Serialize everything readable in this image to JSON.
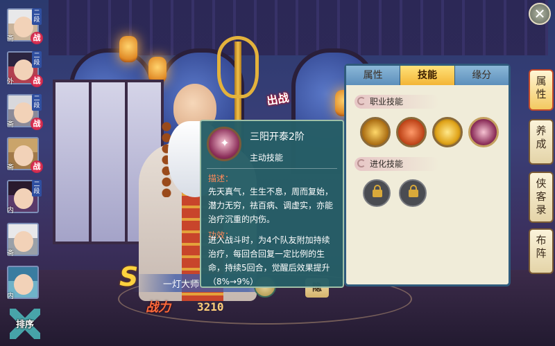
{
  "team": [
    {
      "rank": "二段",
      "faction": "斋",
      "battle": "战"
    },
    {
      "rank": "二段",
      "faction": "外",
      "battle": "战"
    },
    {
      "rank": "二段",
      "faction": "斋",
      "battle": "战"
    },
    {
      "rank": "",
      "faction": "斋",
      "battle": "战"
    },
    {
      "rank": "二段",
      "faction": "内",
      "battle": ""
    },
    {
      "rank": "",
      "faction": "斋",
      "battle": ""
    },
    {
      "rank": "",
      "faction": "内",
      "battle": ""
    }
  ],
  "sort_label": "排序",
  "hero": {
    "deploy_label": "出战",
    "name": "一灯大师",
    "power_label": "战力",
    "power_value": "3210",
    "hide_label": "隐"
  },
  "panel": {
    "tabs": [
      "属性",
      "技能",
      "缘分"
    ],
    "active_tab": "技能",
    "section_career": "职业技能",
    "section_evolve": "进化技能",
    "career_skill_icons": [
      "golden-slash-icon",
      "lotus-flame-icon",
      "citrus-wheel-icon",
      "deer-skill-icon"
    ],
    "locked_icons": [
      "lock-icon",
      "lock-icon"
    ]
  },
  "side_tabs": [
    "属性",
    "养成",
    "侠客录",
    "布阵"
  ],
  "tooltip": {
    "name": "三阳开泰2阶",
    "type": "主动技能",
    "desc_label": "描述：",
    "desc_text": "先天真气，生生不息，周而复始，潜力无穷，祛百病、调虚实，亦能治疗沉重的内伤。",
    "effect_label": "功效：",
    "effect_text": "进入战斗时，为4个队友附加持续治疗，每回合回复一定比例的生命，持续5回合，觉醒后效果提升（8%→9%）"
  },
  "colors": {
    "accent": "#f3b536",
    "panel_bg": "#f0ecd9",
    "tooltip_bg": "#265e66"
  }
}
